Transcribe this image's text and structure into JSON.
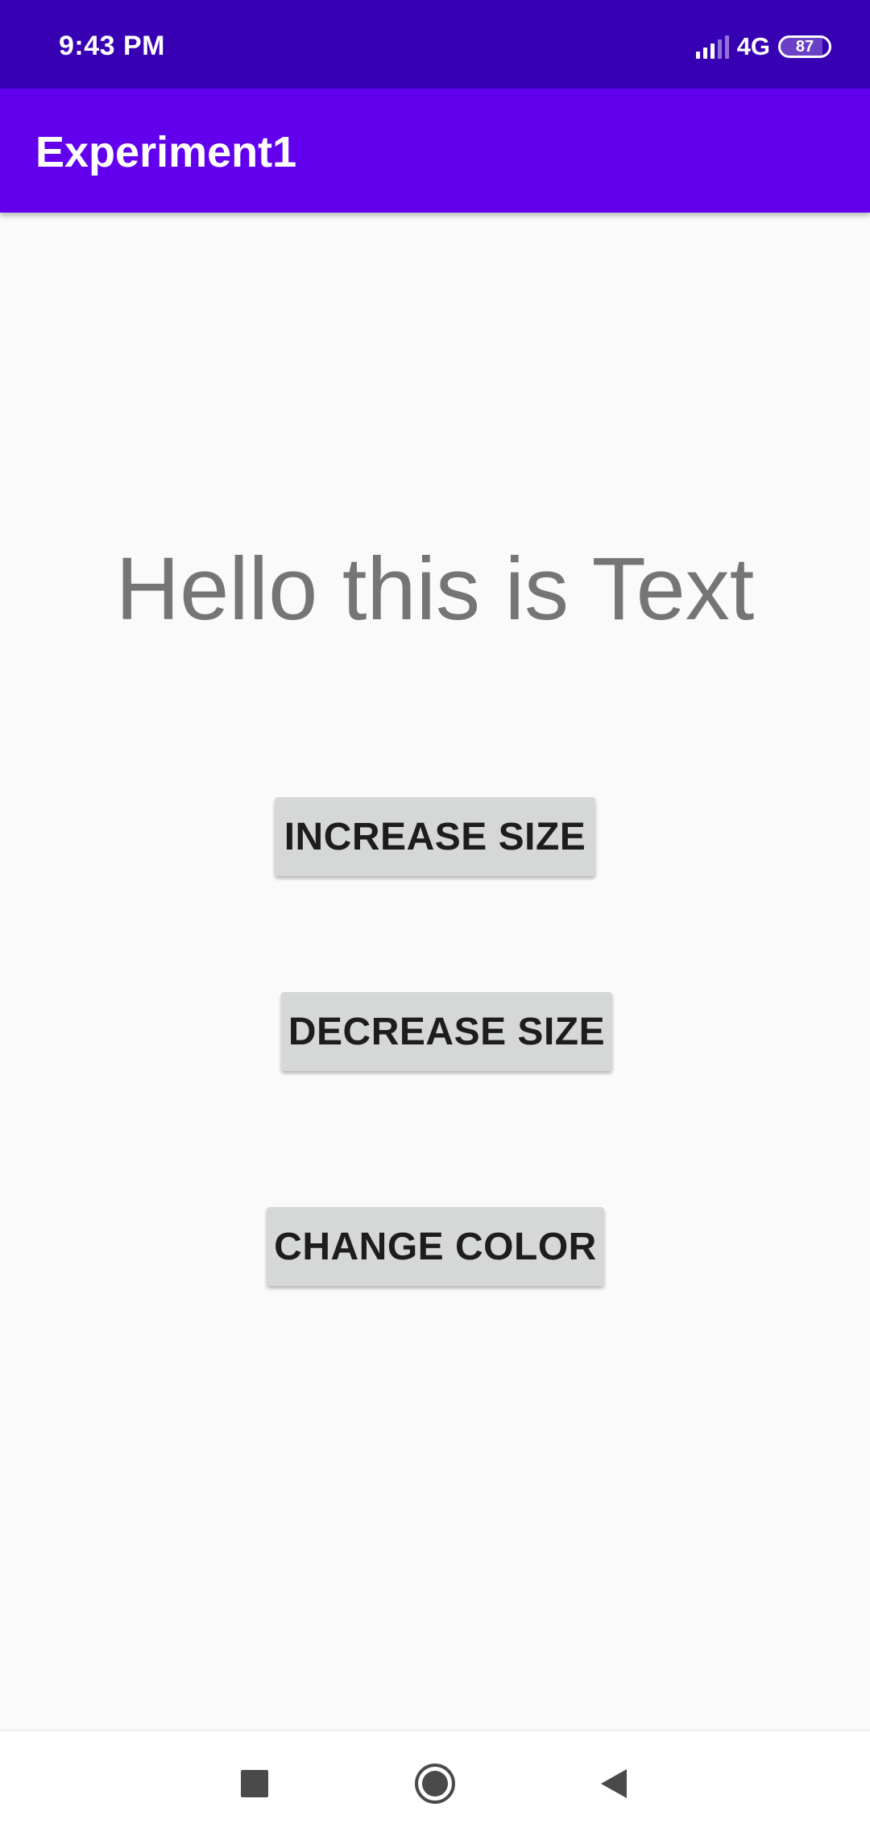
{
  "status_bar": {
    "time": "9:43 PM",
    "network": "4G",
    "battery_level": "87",
    "battery_fraction": 0.87,
    "signal_strength": 3,
    "icons": [
      "signal-icon",
      "battery-icon"
    ],
    "background_color": "#3700B3"
  },
  "app_bar": {
    "title": "Experiment1",
    "background_color": "#6200EE"
  },
  "main": {
    "display_text": "Hello this is Text",
    "display_text_color": "#757575",
    "buttons": [
      {
        "id": "increase",
        "label": "INCREASE SIZE"
      },
      {
        "id": "decrease",
        "label": "DECREASE SIZE"
      },
      {
        "id": "color",
        "label": "CHANGE COLOR"
      }
    ],
    "button_color": "#D6D7D7"
  },
  "nav_bar": {
    "icons": [
      "recents-icon",
      "home-icon",
      "back-icon"
    ]
  }
}
